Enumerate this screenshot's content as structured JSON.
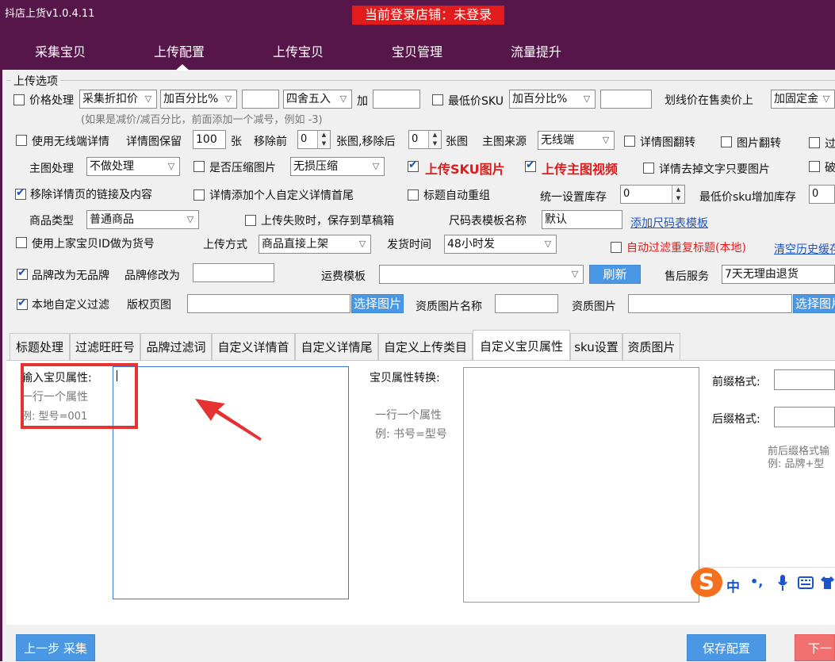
{
  "app": {
    "title": "抖店上货v1.0.4.11",
    "login_status": "当前登录店铺：未登录"
  },
  "nav": {
    "tabs": [
      "采集宝贝",
      "上传配置",
      "上传宝贝",
      "宝贝管理",
      "流量提升"
    ],
    "active_index": 1
  },
  "section_title": "上传选项",
  "row1": {
    "price_label": "价格处理",
    "price_source": "采集折扣价",
    "price_mode": "加百分比%",
    "price_value": "",
    "rounding": "四舍五入",
    "add_label": "加",
    "add_value": "",
    "min_sku_label": "最低价SKU",
    "min_sku_mode": "加百分比%",
    "min_sku_value": "",
    "strike_label": "划线价在售卖价上",
    "strike_mode": "加固定金"
  },
  "hint_text": "(如果是减价/减百分比，前面添加一个减号，例如 -3)",
  "row2": {
    "wireless_label": "使用无线端详情",
    "keep_label": "详情图保留",
    "keep_value": "100",
    "keep_unit": "张",
    "remove_front_label": "移除前",
    "remove_front_value": "0",
    "remove_after_label": "张图,移除后",
    "remove_after_value": "0",
    "remove_unit": "张图",
    "main_source_label": "主图来源",
    "main_source_value": "无线端",
    "detail_flip_label": "详情图翻转",
    "img_flip_label": "图片翻转",
    "cut_label": "过"
  },
  "row3": {
    "main_process_label": "主图处理",
    "main_process_value": "不做处理",
    "compress_label": "是否压缩图片",
    "compress_value": "无损压缩",
    "upload_sku_label": "上传SKU图片",
    "upload_video_label": "上传主图视频",
    "detail_text_label": "详情去掉文字只要图片",
    "cut2_label": "破"
  },
  "row4": {
    "remove_links_label": "移除详情页的链接及内容",
    "custom_detail_label": "详情添加个人自定义详情首尾",
    "title_regroup_label": "标题自动重组",
    "stock_label": "统一设置库存",
    "stock_value": "0",
    "min_sku_stock_label": "最低价sku增加库存",
    "min_sku_stock_value": "0"
  },
  "row5": {
    "product_type_label": "商品类型",
    "product_type_value": "普通商品",
    "draft_label": "上传失败时，保存到草稿箱",
    "size_template_label": "尺码表模板名称",
    "size_template_value": "默认",
    "add_size_link": "添加尺码表模板"
  },
  "row6": {
    "use_id_label": "使用上家宝贝ID做为货号",
    "upload_method_label": "上传方式",
    "upload_method_value": "商品直接上架",
    "ship_time_label": "发货时间",
    "ship_time_value": "48小时发",
    "auto_filter_label": "自动过滤重复标题(本地)",
    "clear_history_link": "清空历史缓存"
  },
  "row7": {
    "no_brand_label": "品牌改为无品牌",
    "brand_change_label": "品牌修改为",
    "brand_change_value": "",
    "freight_label": "运费模板",
    "freight_value": "",
    "refresh_label": "刷新",
    "after_sale_label": "售后服务",
    "after_sale_value": "7天无理由退货"
  },
  "row8": {
    "local_filter_label": "本地自定义过滤",
    "copyright_label": "版权页图",
    "copyright_value": "",
    "choose_image_label": "选择图片",
    "qual_name_label": "资质图片名称",
    "qual_name_value": "",
    "qual_image_label": "资质图片",
    "qual_image_value": "",
    "choose_image2_label": "选择图片"
  },
  "subtabs": [
    "标题处理",
    "过滤旺旺号",
    "品牌过滤词",
    "自定义详情首",
    "自定义详情尾",
    "自定义上传类目",
    "自定义宝贝属性",
    "sku设置",
    "资质图片"
  ],
  "subtab_active": 6,
  "attr_panel": {
    "input_label": "输入宝贝属性:",
    "input_hint1": "一行一个属性",
    "input_hint2": "例: 型号=001",
    "convert_label": "宝贝属性转换:",
    "convert_hint1": "一行一个属性",
    "convert_hint2": "例: 书号=型号",
    "prefix_label": "前缀格式:",
    "suffix_label": "后缀格式:",
    "format_hint1": "前后缀格式输",
    "format_hint2": "例: 品牌+型"
  },
  "ime": {
    "logo": "S",
    "chinese": "中",
    "punct": "•,"
  },
  "footer": {
    "prev_label": "上一步 采集",
    "save_label": "保存配置",
    "next_label": "下一步"
  },
  "colors": {
    "titlebar": "#57164a",
    "login_badge": "#e21c1c",
    "button_blue": "#4a97e4",
    "button_red": "#f07070",
    "highlight": "#e53333"
  }
}
